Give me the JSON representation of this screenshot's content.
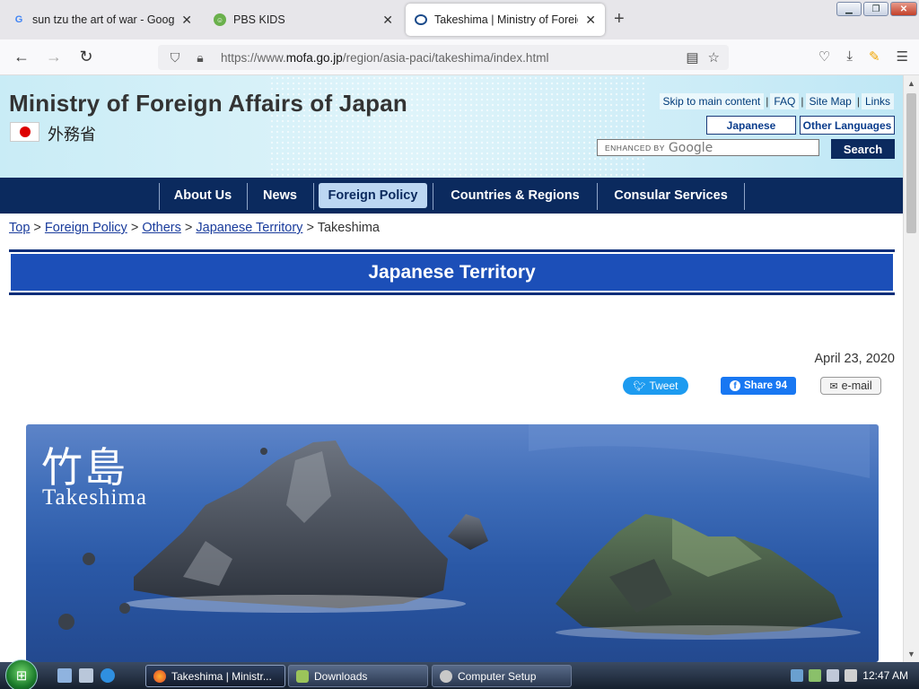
{
  "browser": {
    "tabs": [
      {
        "title": "sun tzu the art of war - Google S",
        "favicon": "G"
      },
      {
        "title": "PBS KIDS",
        "favicon": "pbs-icon"
      },
      {
        "title": "Takeshima | Ministry of Foreign",
        "favicon": "loading-icon"
      }
    ],
    "url_prefix": "https://www.",
    "url_domain": "mofa.go.jp",
    "url_path": "/region/asia-paci/takeshima/index.html"
  },
  "site": {
    "title": "Ministry of Foreign Affairs of Japan",
    "title_jp": "外務省",
    "top_links": [
      "Skip to main content",
      "FAQ",
      "Site Map",
      "Links"
    ],
    "lang_japanese": "Japanese",
    "lang_other": "Other Languages",
    "search_label": "ENHANCED BY",
    "search_brand": "Google",
    "search_button": "Search"
  },
  "nav": {
    "items": [
      "About Us",
      "News",
      "Foreign Policy",
      "Countries & Regions",
      "Consular Services"
    ],
    "active": "Foreign Policy"
  },
  "breadcrumb": {
    "links": [
      "Top",
      "Foreign Policy",
      "Others",
      "Japanese Territory"
    ],
    "current": "Takeshima",
    "separator": ">"
  },
  "content": {
    "section_title": "Japanese Territory",
    "date": "April 23, 2020",
    "tweet_label": "Tweet",
    "fb_label": "Share 94",
    "email_label": "e-mail",
    "hero_title_jp": "竹島",
    "hero_title_en": "Takeshima"
  },
  "taskbar": {
    "tasks": [
      "Takeshima | Ministr...",
      "Downloads",
      "Computer Setup"
    ],
    "clock": "12:47 AM"
  },
  "colors": {
    "nav_bg": "#0b2a5e",
    "section_bg": "#1c4fb8",
    "nav_active": "#bcd7f2"
  }
}
